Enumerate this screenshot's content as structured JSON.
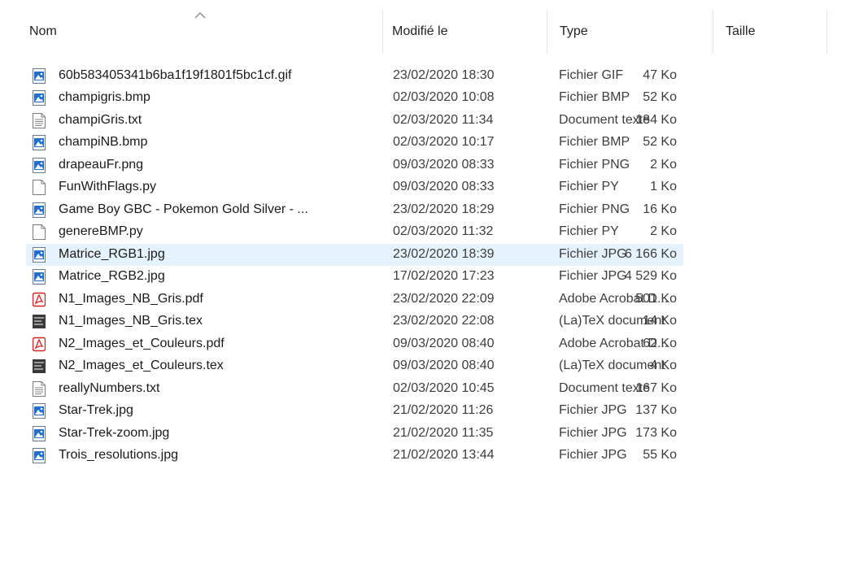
{
  "columns": {
    "name": "Nom",
    "modified": "Modifié le",
    "type": "Type",
    "size": "Taille"
  },
  "files": [
    {
      "name": "60b583405341b6ba1f19f1801f5bc1cf.gif",
      "modified": "23/02/2020 18:30",
      "type": "Fichier GIF",
      "size": "47 Ko",
      "icon": "image-file-icon"
    },
    {
      "name": "champigris.bmp",
      "modified": "02/03/2020 10:08",
      "type": "Fichier BMP",
      "size": "52 Ko",
      "icon": "image-file-icon"
    },
    {
      "name": "champiGris.txt",
      "modified": "02/03/2020 11:34",
      "type": "Document texte",
      "size": "184 Ko",
      "icon": "text-file-icon"
    },
    {
      "name": "champiNB.bmp",
      "modified": "02/03/2020 10:17",
      "type": "Fichier BMP",
      "size": "52 Ko",
      "icon": "image-file-icon"
    },
    {
      "name": "drapeauFr.png",
      "modified": "09/03/2020 08:33",
      "type": "Fichier PNG",
      "size": "2 Ko",
      "icon": "image-file-icon"
    },
    {
      "name": "FunWithFlags.py",
      "modified": "09/03/2020 08:33",
      "type": "Fichier PY",
      "size": "1 Ko",
      "icon": "blank-file-icon"
    },
    {
      "name": "Game Boy GBC - Pokemon Gold Silver - ...",
      "modified": "23/02/2020 18:29",
      "type": "Fichier PNG",
      "size": "16 Ko",
      "icon": "image-file-icon"
    },
    {
      "name": "genereBMP.py",
      "modified": "02/03/2020 11:32",
      "type": "Fichier PY",
      "size": "2 Ko",
      "icon": "blank-file-icon"
    },
    {
      "name": "Matrice_RGB1.jpg",
      "modified": "23/02/2020 18:39",
      "type": "Fichier JPG",
      "size": "6 166 Ko",
      "icon": "image-file-icon",
      "selected": true
    },
    {
      "name": "Matrice_RGB2.jpg",
      "modified": "17/02/2020 17:23",
      "type": "Fichier JPG",
      "size": "4 529 Ko",
      "icon": "image-file-icon"
    },
    {
      "name": "N1_Images_NB_Gris.pdf",
      "modified": "23/02/2020 22:09",
      "type": "Adobe Acrobat D...",
      "size": "501 Ko",
      "icon": "pdf-file-icon"
    },
    {
      "name": "N1_Images_NB_Gris.tex",
      "modified": "23/02/2020 22:08",
      "type": "(La)TeX document",
      "size": "14 Ko",
      "icon": "tex-file-icon"
    },
    {
      "name": "N2_Images_et_Couleurs.pdf",
      "modified": "09/03/2020 08:40",
      "type": "Adobe Acrobat D...",
      "size": "62 Ko",
      "icon": "pdf-file-icon"
    },
    {
      "name": "N2_Images_et_Couleurs.tex",
      "modified": "09/03/2020 08:40",
      "type": "(La)TeX document",
      "size": "4 Ko",
      "icon": "tex-file-icon"
    },
    {
      "name": "reallyNumbers.txt",
      "modified": "02/03/2020 10:45",
      "type": "Document texte",
      "size": "167 Ko",
      "icon": "text-file-icon"
    },
    {
      "name": "Star-Trek.jpg",
      "modified": "21/02/2020 11:26",
      "type": "Fichier JPG",
      "size": "137 Ko",
      "icon": "image-file-icon"
    },
    {
      "name": "Star-Trek-zoom.jpg",
      "modified": "21/02/2020 11:35",
      "type": "Fichier JPG",
      "size": "173 Ko",
      "icon": "image-file-icon"
    },
    {
      "name": "Trois_resolutions.jpg",
      "modified": "21/02/2020 13:44",
      "type": "Fichier JPG",
      "size": "55 Ko",
      "icon": "image-file-icon"
    }
  ],
  "colors": {
    "selection": "#e5f3ff",
    "image_icon_blue": "#1e6fd0",
    "pdf_red": "#d42020",
    "tex_dark": "#3a3a3a"
  }
}
